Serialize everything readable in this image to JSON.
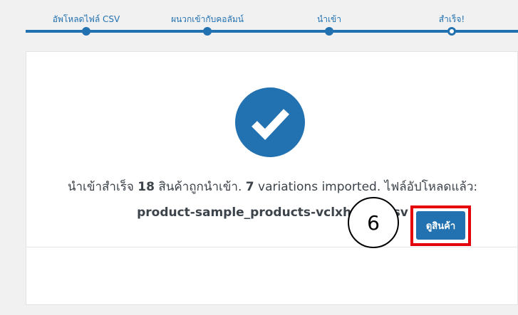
{
  "steps": {
    "items": [
      {
        "label": "อัพโหลดไฟล์ CSV",
        "state": "complete"
      },
      {
        "label": "ผนวกเข้ากับคอลัมน์",
        "state": "complete"
      },
      {
        "label": "นำเข้า",
        "state": "complete"
      },
      {
        "label": "สำเร็จ!",
        "state": "current"
      }
    ]
  },
  "result": {
    "icon": "checkmark-icon",
    "prefix": "นำเข้าสำเร็จ ",
    "imported_count": "18",
    "imported_text": " สินค้าถูกนำเข้า. ",
    "variations_count": "7",
    "variations_text": " variations imported. ไฟล์อัปโหลดแล้ว:",
    "filename": "product-sample_products-vclxhrhizl.csv"
  },
  "actions": {
    "view_products_label": "ดูสินค้า"
  },
  "annotation": {
    "step_number": "6"
  },
  "colors": {
    "accent": "#2271b1",
    "highlight": "#e3000b",
    "background": "#f1f1f1"
  }
}
